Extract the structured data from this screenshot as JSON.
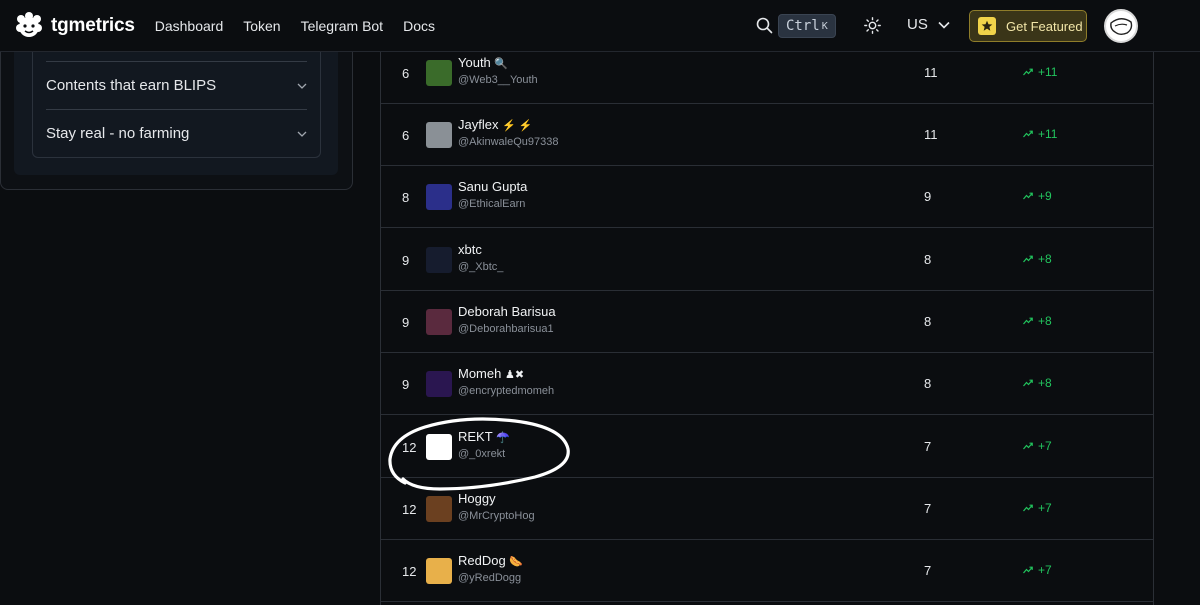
{
  "header": {
    "brand": "tgmetrics",
    "nav": [
      "Dashboard",
      "Token",
      "Telegram Bot",
      "Docs"
    ],
    "search_shortcut": "Ctrl",
    "search_shortcut_key": "K",
    "language": "US",
    "featured_label": "Get Featured"
  },
  "sidebar": {
    "accordion": [
      {
        "label": "Contents that earn BLIPS"
      },
      {
        "label": "Stay real - no farming"
      }
    ]
  },
  "leaderboard": {
    "rows": [
      {
        "rank": "6",
        "name": "Youth",
        "badge": "🔍",
        "handle": "@Web3__Youth",
        "count": "11",
        "change": "+11",
        "avatar_color": "#3a6b2a"
      },
      {
        "rank": "6",
        "name": "Jayflex",
        "badge": "⚡ ⚡",
        "handle": "@AkinwaleQu97338",
        "count": "11",
        "change": "+11",
        "avatar_color": "#8a9096"
      },
      {
        "rank": "8",
        "name": "Sanu Gupta",
        "badge": "",
        "handle": "@EthicalEarn",
        "count": "9",
        "change": "+9",
        "avatar_color": "#2b2f8a"
      },
      {
        "rank": "9",
        "name": "xbtc",
        "badge": "",
        "handle": "@_Xbtc_",
        "count": "8",
        "change": "+8",
        "avatar_color": "#161c2e"
      },
      {
        "rank": "9",
        "name": "Deborah Barisua",
        "badge": "",
        "handle": "@Deborahbarisua1",
        "count": "8",
        "change": "+8",
        "avatar_color": "#5a2a3e"
      },
      {
        "rank": "9",
        "name": "Momeh",
        "badge": "♟✖",
        "handle": "@encryptedmomeh",
        "count": "8",
        "change": "+8",
        "avatar_color": "#2a1650"
      },
      {
        "rank": "12",
        "name": "REKT",
        "badge": "☂️",
        "handle": "@_0xrekt",
        "count": "7",
        "change": "+7",
        "avatar_color": "#ffffff"
      },
      {
        "rank": "12",
        "name": "Hoggy",
        "badge": "",
        "handle": "@MrCryptoHog",
        "count": "7",
        "change": "+7",
        "avatar_color": "#6b4020"
      },
      {
        "rank": "12",
        "name": "RedDog",
        "badge": "🌭",
        "handle": "@yRedDogg",
        "count": "7",
        "change": "+7",
        "avatar_color": "#e8b04a"
      }
    ]
  },
  "colors": {
    "background": "#0b0d10",
    "accent_green": "#22c55e",
    "featured_gold": "#f0d34a"
  }
}
